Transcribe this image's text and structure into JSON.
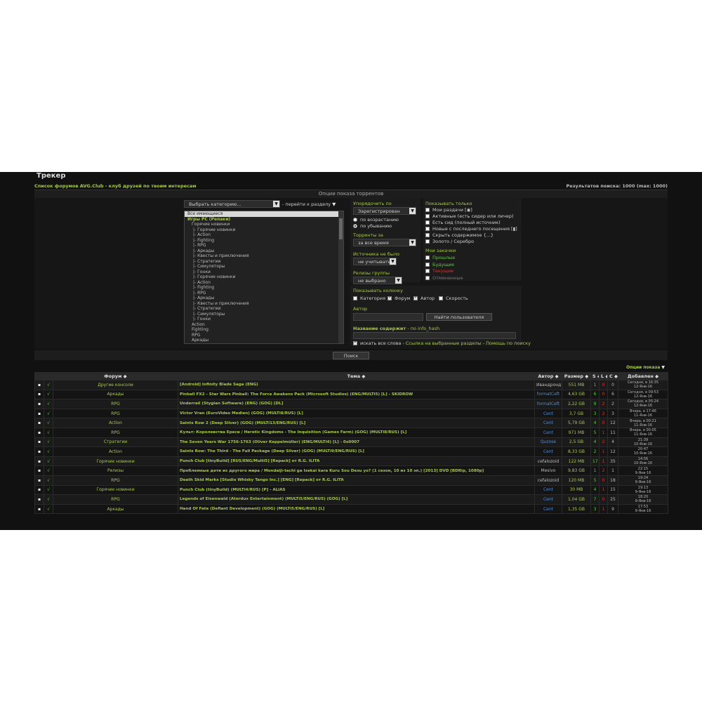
{
  "header": {
    "title": "Трекер",
    "forum_link": "Список форумов AVG.Club - клуб друзей по твоим интересам",
    "results": "Результатов поиска: 1000 (max: 1000)"
  },
  "options": {
    "title": "Опции показа торрентов",
    "category_select": "Выбрать категорию...",
    "goto_section": "- перейти к разделу",
    "categories": [
      {
        "label": "Все имеющиеся",
        "type": "sel"
      },
      {
        "label": "Игры PC (Репаки)",
        "type": "grp"
      },
      {
        "label": "Горячие новинки",
        "type": "sub"
      },
      {
        "label": "|- Горячие новинки",
        "type": "sub2"
      },
      {
        "label": "|- Action",
        "type": "sub2"
      },
      {
        "label": "|- Fighting",
        "type": "sub2"
      },
      {
        "label": "|- RPG",
        "type": "sub2"
      },
      {
        "label": "|- Аркады",
        "type": "sub2"
      },
      {
        "label": "|- Квесты и приключения",
        "type": "sub2"
      },
      {
        "label": "|- Стратегии",
        "type": "sub2"
      },
      {
        "label": "|- Симуляторы",
        "type": "sub2"
      },
      {
        "label": "|- Гонки",
        "type": "sub2"
      },
      {
        "label": "|- Горячие новинки",
        "type": "sub2"
      },
      {
        "label": "|- Action",
        "type": "sub2"
      },
      {
        "label": "|- Fighting",
        "type": "sub2"
      },
      {
        "label": "|- RPG",
        "type": "sub2"
      },
      {
        "label": "|- Аркады",
        "type": "sub2"
      },
      {
        "label": "|- Квесты и приключения",
        "type": "sub2"
      },
      {
        "label": "|- Стратегии",
        "type": "sub2"
      },
      {
        "label": "|- Симуляторы",
        "type": "sub2"
      },
      {
        "label": "|- Гонки",
        "type": "sub2"
      },
      {
        "label": "Action",
        "type": "sub"
      },
      {
        "label": "Fighting",
        "type": "sub"
      },
      {
        "label": "RPG",
        "type": "sub"
      },
      {
        "label": "Аркады",
        "type": "sub"
      }
    ],
    "sort_label": "Упорядочить по",
    "sort_value": "Зарегистрирован",
    "sort_asc": "по возрастанию",
    "sort_desc": "по убыванию",
    "period_label": "Торренты за",
    "period_value": "за все время",
    "source_label": "Источника не было",
    "source_value": "не учитывать",
    "group_label": "Релизы группы",
    "group_value": "не выбрано",
    "show_only_label": "Показывать только",
    "show_only": [
      {
        "label": "Мои раздачи [◉]",
        "checked": false
      },
      {
        "label": "Активные (есть сидер или личер)",
        "checked": false
      },
      {
        "label": "Есть сид (полный источник)",
        "checked": false
      },
      {
        "label": "Новые с последнего посещения [▮]",
        "checked": false
      },
      {
        "label": "Скрыть содержимое {...}",
        "checked": false
      },
      {
        "label": "Золото / Серебро",
        "checked": false
      }
    ],
    "downloads_label": "Мои закачки",
    "downloads": [
      {
        "label": "Прошлые",
        "color": "#5cc93a"
      },
      {
        "label": "Будущие",
        "color": "#5cc93a"
      },
      {
        "label": "Текущие",
        "color": "#e03030"
      },
      {
        "label": "Отмененные",
        "color": "#777777"
      }
    ],
    "show_column_label": "Показывать колонку",
    "columns": [
      {
        "label": "Категория",
        "checked": false
      },
      {
        "label": "Форум",
        "checked": true
      },
      {
        "label": "Автор",
        "checked": true
      },
      {
        "label": "Скорость",
        "checked": false
      }
    ],
    "author_label": "Автор",
    "find_user": "Найти пользователя",
    "title_contains": "Название содержит",
    "info_hash": "- по info_hash",
    "all_words": "искать все слова",
    "links": "- Ссылка на выбранные разделы - Помощь по поиску",
    "search_button": "Поиск"
  },
  "display_options": "Опции показа",
  "table": {
    "headers": {
      "forum": "Форум ◆",
      "topic": "Тема ◆",
      "author": "Автор ◆",
      "size": "Размер ◆",
      "s": "S ◆",
      "l": "L ◆",
      "c": "C ◆",
      "added": "Добавлен ◆"
    },
    "rows": [
      {
        "forum": "Другие консоли",
        "topic": "[Android] Infinity Blade Saga (ENG)",
        "author": "Ивандронд",
        "blue": false,
        "size": "551 MB",
        "s": "1",
        "l": "0",
        "c": "0",
        "d1": "Сегодня, в 16:35",
        "d2": "12-Янв-16"
      },
      {
        "forum": "Аркады",
        "topic": "Pinball FX2 - Star Wars Pinball: The Force Awakens Pack (Microsoft Studios) (ENG/MULTi5) [L] - SKIDROW",
        "author": "formatCeft",
        "blue": true,
        "size": "4,63 GB",
        "s": "6",
        "l": "0",
        "c": "6",
        "d1": "Сегодня, в 09:53",
        "d2": "12-Янв-16"
      },
      {
        "forum": "RPG",
        "topic": "Underrail (Stygian Software) (ENG) (GOG) [DL]",
        "author": "formatCeft",
        "blue": true,
        "size": "2,22 GB",
        "s": "9",
        "l": "2",
        "c": "2",
        "d1": "Сегодня, в 05:24",
        "d2": "12-Янв-16"
      },
      {
        "forum": "RPG",
        "topic": "Victor Vran (EuroVideo Medien) (GOG) (MULTi8/RUS) [L]",
        "author": "Cent",
        "blue": true,
        "size": "3,7 GB",
        "s": "3",
        "l": "2",
        "c": "3",
        "d1": "Вчера, в 17:46",
        "d2": "11-Янв-16"
      },
      {
        "forum": "Action",
        "topic": "Saints Row 2 (Deep Silver) (GOG) (MULTi13/ENG/RUS) [L]",
        "author": "Cent",
        "blue": true,
        "size": "5,79 GB",
        "s": "4",
        "l": "0",
        "c": "12",
        "d1": "Вчера, в 00:21",
        "d2": "11-Янв-16"
      },
      {
        "forum": "RPG",
        "topic": "Культ: Королевства Ереси / Heretic Kingdoms - The Inquisition (Games Farm) (GOG) (MULTi8/RUS) [L]",
        "author": "Cent",
        "blue": true,
        "size": "971 MB",
        "s": "5",
        "l": "1",
        "c": "11",
        "d1": "Вчера, в 00:05",
        "d2": "11-Янв-16"
      },
      {
        "forum": "Стратегии",
        "topic": "The Seven Years War 1756-1763 (Oliver Keppelmüller) (ENG/MULTi4) [L] - 0x0007",
        "author": "Quzose",
        "blue": true,
        "size": "2,5 GB",
        "s": "4",
        "l": "2",
        "c": "4",
        "d1": "21:39",
        "d2": "10-Янв-16"
      },
      {
        "forum": "Action",
        "topic": "Saints Row: The Third - The Full Package (Deep Silver) (GOG) (MULTi9/ENG/RUS) [L]",
        "author": "Cent",
        "blue": true,
        "size": "8,33 GB",
        "s": "2",
        "l": "1",
        "c": "12",
        "d1": "20:47",
        "d2": "10-Янв-16"
      },
      {
        "forum": "Горячие новинки",
        "topic": "Punch Club [tinyBuild] [RUS/ENG/Multi5] [Repack] от R.G. ILITA",
        "author": "cefalozoid",
        "blue": false,
        "size": "122 MB",
        "s": "17",
        "l": "1",
        "c": "35",
        "d1": "14:56",
        "d2": "10-Янв-16"
      },
      {
        "forum": "Релизы",
        "topic": "Проблемные дети из другого мира / Mondaiji-tachi ga Isekai kara Kuru Sou Desu yo? (1 сезон, 10 из 10 эп.) [2013] DVD [BDRip, 1080p]",
        "author": "Mesivo",
        "blue": false,
        "size": "9,83 GB",
        "s": "1",
        "l": "2",
        "c": "1",
        "d1": "22:15",
        "d2": "9-Янв-16"
      },
      {
        "forum": "RPG",
        "topic": "Death Skid Marks [Studio Whisky Tango Inc.] [ENG] [Repack] от R.G. ILITA",
        "author": "cefalozoid",
        "blue": false,
        "size": "120 MB",
        "s": "5",
        "l": "0",
        "c": "18",
        "d1": "19:24",
        "d2": "9-Янв-16"
      },
      {
        "forum": "Горячие новинки",
        "topic": "Punch Club (tinyBuild) (MULTi4/RUS) [P] - ALiAS",
        "author": "Cent",
        "blue": true,
        "size": "30 MB",
        "s": "4",
        "l": "1",
        "c": "15",
        "d1": "19:13",
        "d2": "9-Янв-16"
      },
      {
        "forum": "RPG",
        "topic": "Legends of Eisenwald (Aterdux Entertainment) (MULTi5/ENG/RUS) (GOG) [L]",
        "author": "Cent",
        "blue": true,
        "size": "1,04 GB",
        "s": "7",
        "l": "0",
        "c": "25",
        "d1": "18:20",
        "d2": "9-Янв-16"
      },
      {
        "forum": "Аркады",
        "topic": "Hand Of Fate (Defiant Development) (GOG) (MULTi5/ENG/RUS) [L]",
        "author": "Cent",
        "blue": true,
        "size": "1,35 GB",
        "s": "3",
        "l": "1",
        "c": "9",
        "d1": "17:53",
        "d2": "9-Янв-16"
      }
    ]
  }
}
